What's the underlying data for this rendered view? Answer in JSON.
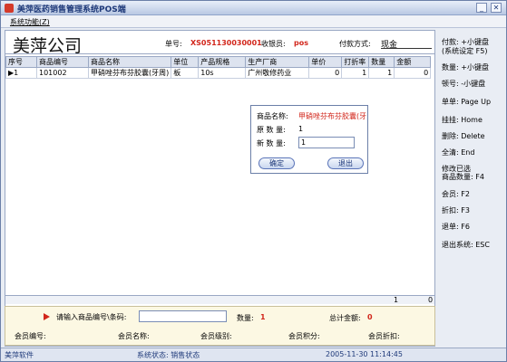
{
  "window": {
    "title": "美萍医药销售管理系统POS端"
  },
  "menu": {
    "system": "系统功能(Z)"
  },
  "header": {
    "company": "美萍公司",
    "order_label": "单号:",
    "order_no": "XS051130030001",
    "cashier_label": "收银员:",
    "cashier": "pos",
    "pay_label": "付款方式:",
    "pay_value": "现金"
  },
  "grid": {
    "columns": [
      "序号",
      "商品编号",
      "商品名称",
      "单位",
      "产品规格",
      "生产厂商",
      "单价",
      "打折率",
      "数量",
      "金额"
    ],
    "rows": [
      [
        "1",
        "101002",
        "甲硝唑芬布芬胶囊(牙周)",
        "板",
        "10s",
        "广州敬修药业",
        "0",
        "1",
        "1",
        "0"
      ]
    ],
    "footer_qty": "1",
    "footer_amount": "0"
  },
  "dialog": {
    "name_label": "商品名称:",
    "name_value": "甲硝唑芬布芬胶囊(牙",
    "orig_qty_label": "原 数 量:",
    "orig_qty_value": "1",
    "new_qty_label": "新 数 量:",
    "new_qty_value": "1",
    "ok": "确定",
    "exit": "退出"
  },
  "bottom": {
    "code_prompt": "请输入商品编号\\条码:",
    "code_value": "",
    "qty_label": "数量:",
    "qty_value": "1",
    "total_label": "总计金额:",
    "total_value": "0",
    "member_no": "会员编号:",
    "member_name": "会员名称:",
    "member_level": "会员级别:",
    "member_points": "会员积分:",
    "member_discount": "会员折扣:"
  },
  "shortcuts": {
    "pay": "付款:    +小键盘",
    "pay_sub": "(系统设定 F5)",
    "qty": "数量:    +小键盘",
    "del_num": "顿号:    -小键盘",
    "pageup": "单单:     Page Up",
    "suspend": "挂挂:     Home",
    "delete": "删除:     Delete",
    "clear": "全清:     End",
    "modify_title": "修改已选",
    "modify": "商品数量:  F4",
    "member": "会员:     F2",
    "discount": "折扣:     F3",
    "refund": "退单:     F6",
    "exit": "退出系统:  ESC"
  },
  "status": {
    "company": "美萍软件",
    "state": "系统状态: 销售状态",
    "datetime": "2005-11-30 11:14:45"
  }
}
